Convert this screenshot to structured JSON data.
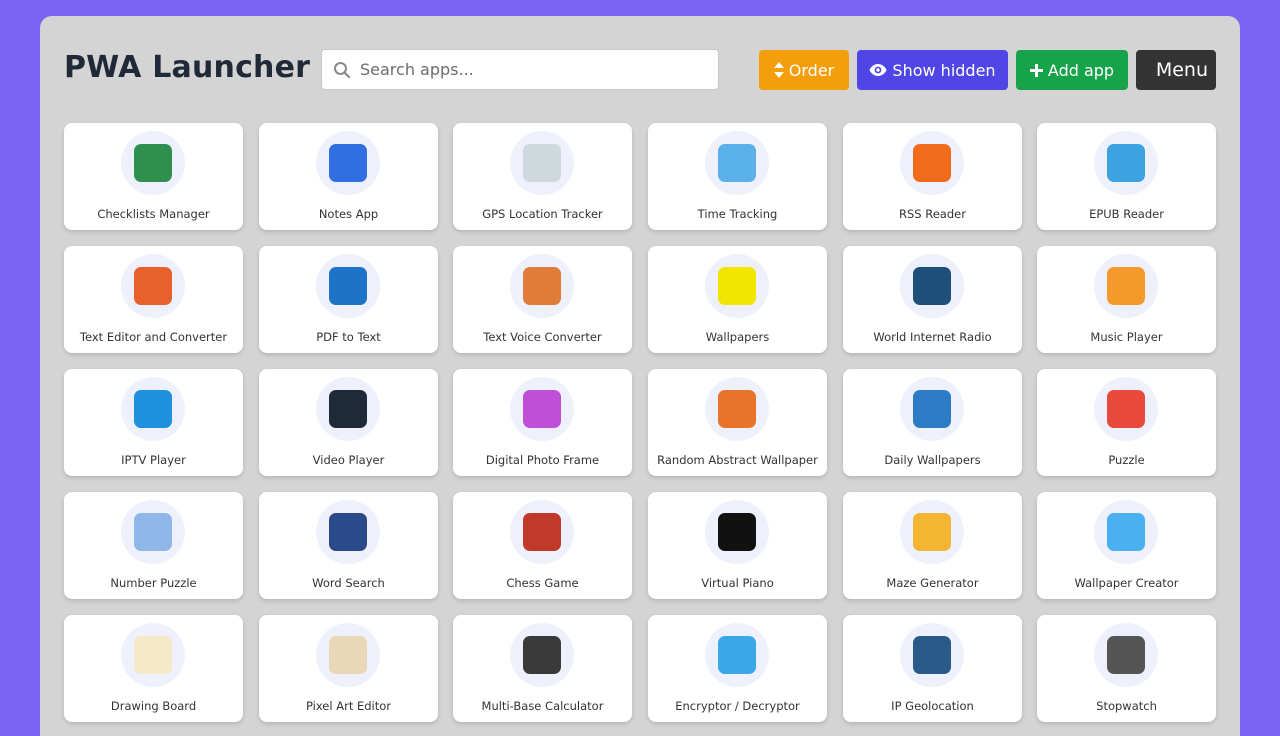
{
  "header": {
    "title": "PWA Launcher",
    "search_placeholder": "Search apps...",
    "buttons": {
      "order": "Order",
      "show_hidden": "Show hidden",
      "add_app": "Add app",
      "menu": "Menu"
    }
  },
  "colors": {
    "background": "#7a63f0",
    "panel": "#d4d4d4",
    "order": "#f59e0b",
    "show_hidden": "#4f46e5",
    "add_app": "#16a34a",
    "menu": "#333333"
  },
  "apps": [
    {
      "name": "Checklists Manager",
      "icon": "clipboard-checklist-icon",
      "color": "#2f8f4e"
    },
    {
      "name": "Notes App",
      "icon": "note-pencil-icon",
      "color": "#2f6fe0"
    },
    {
      "name": "GPS Location Tracker",
      "icon": "location-target-icon",
      "color": "#cfd8dc"
    },
    {
      "name": "Time Tracking",
      "icon": "calendar-clock-icon",
      "color": "#5ab0e8"
    },
    {
      "name": "RSS Reader",
      "icon": "rss-feed-icon",
      "color": "#f26a1b"
    },
    {
      "name": "EPUB Reader",
      "icon": "books-epub-icon",
      "color": "#3aa3e0"
    },
    {
      "name": "Text Editor and Converter",
      "icon": "document-text-icon",
      "color": "#e8602c"
    },
    {
      "name": "PDF to Text",
      "icon": "pdf-document-icon",
      "color": "#1e73c8"
    },
    {
      "name": "Text Voice Converter",
      "icon": "microphone-chat-icon",
      "color": "#e07b39"
    },
    {
      "name": "Wallpapers",
      "icon": "wallpaper-text-icon",
      "color": "#f2e600"
    },
    {
      "name": "World Internet Radio",
      "icon": "globe-icon",
      "color": "#1d4f7a"
    },
    {
      "name": "Music Player",
      "icon": "music-note-play-icon",
      "color": "#f59a2a"
    },
    {
      "name": "IPTV Player",
      "icon": "tv-icon",
      "color": "#1f8fe0"
    },
    {
      "name": "Video Player",
      "icon": "film-play-icon",
      "color": "#1e2a3a"
    },
    {
      "name": "Digital Photo Frame",
      "icon": "photo-stack-icon",
      "color": "#c04fd8"
    },
    {
      "name": "Random Abstract Wallpaper",
      "icon": "abstract-wallpaper-icon",
      "color": "#e8742c"
    },
    {
      "name": "Daily Wallpapers",
      "icon": "landscape-wallpaper-icon",
      "color": "#2c7bc4"
    },
    {
      "name": "Puzzle",
      "icon": "puzzle-grid-icon",
      "color": "#e84a3c"
    },
    {
      "name": "Number Puzzle",
      "icon": "number-grid-icon",
      "color": "#8fb8e8"
    },
    {
      "name": "Word Search",
      "icon": "magnifier-letters-icon",
      "color": "#2a4a8a"
    },
    {
      "name": "Chess Game",
      "icon": "chess-piece-icon",
      "color": "#c0392b"
    },
    {
      "name": "Virtual Piano",
      "icon": "piano-keys-icon",
      "color": "#111111"
    },
    {
      "name": "Maze Generator",
      "icon": "maze-icon",
      "color": "#f2b632"
    },
    {
      "name": "Wallpaper Creator",
      "icon": "paint-brush-icon",
      "color": "#4ab0f0"
    },
    {
      "name": "Drawing Board",
      "icon": "pencil-board-icon",
      "color": "#f5e9c8"
    },
    {
      "name": "Pixel Art Editor",
      "icon": "pixel-brush-icon",
      "color": "#e8d8b8"
    },
    {
      "name": "Multi-Base Calculator",
      "icon": "calculator-icon",
      "color": "#3a3a3a"
    },
    {
      "name": "Encryptor / Decryptor",
      "icon": "padlock-icon",
      "color": "#3aa8e8"
    },
    {
      "name": "IP Geolocation",
      "icon": "geolocation-pin-icon",
      "color": "#2a5a8a"
    },
    {
      "name": "Stopwatch",
      "icon": "stopwatch-icon",
      "color": "#555555"
    }
  ]
}
